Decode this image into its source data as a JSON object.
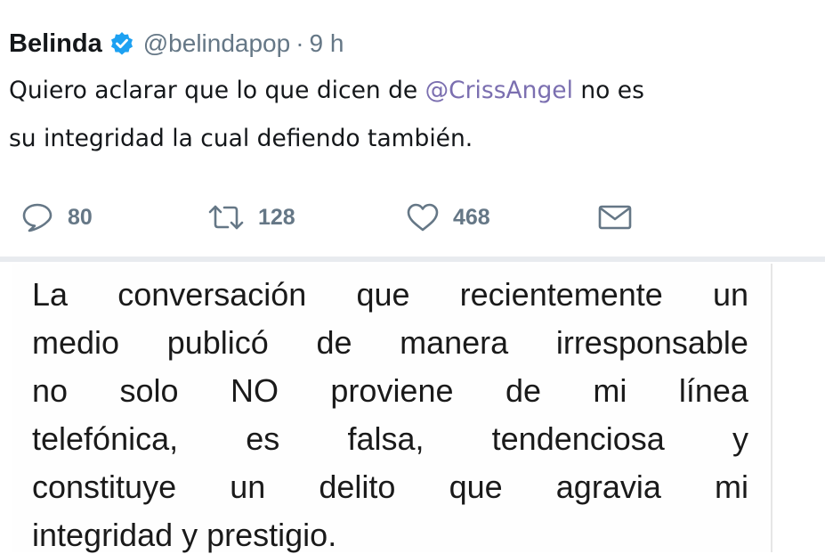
{
  "tweet": {
    "name": "Belinda",
    "handle": "@belindapop",
    "separator": "·",
    "time": "9 h",
    "text_line1_before": "Quiero aclarar que lo que dicen de ",
    "mention": "@CrissAngel",
    "text_line1_after": " no es",
    "text_line2": "su integridad la cual defiendo también.",
    "actions": {
      "reply_count": "80",
      "retweet_count": "128",
      "like_count": "468"
    },
    "colors": {
      "verified": "#1da1f2",
      "muted": "#657786",
      "mention": "#7b6fb0"
    }
  },
  "statement": {
    "lines": [
      "La conversación que recientemente un",
      "medio publicó de manera irresponsable",
      "no solo NO proviene de mi línea",
      "telefónica, es falsa, tendenciosa y",
      "constituye un delito que agravia mi",
      "integridad y prestigio."
    ]
  }
}
